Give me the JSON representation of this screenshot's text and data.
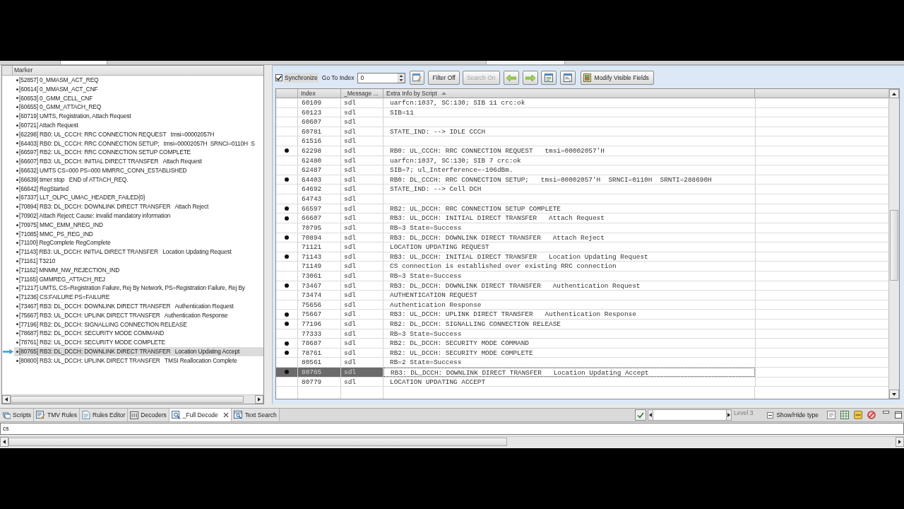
{
  "marker_panel": {
    "header": "Marker",
    "items": [
      {
        "text": "[52857] 0_MMASM_ACT_REQ",
        "selected": false
      },
      {
        "text": "[60614] 0_MMASM_ACT_CNF",
        "selected": false
      },
      {
        "text": "[60653] 0_GMM_CELL_CNF",
        "selected": false
      },
      {
        "text": "[60655] 0_GMM_ATTACH_REQ",
        "selected": false
      },
      {
        "text": "[60719] UMTS, Registration, Attach Request",
        "selected": false
      },
      {
        "text": "[60721] Attach Request",
        "selected": false
      },
      {
        "text": "[62298] RB0: UL_CCCH: RRC CONNECTION REQUEST   tmsi=00002057H",
        "selected": false
      },
      {
        "text": "[64403] RB0: DL_CCCH: RRC CONNECTION SETUP;   tmsi=00002057H  SRNCI=0110H  S",
        "selected": false
      },
      {
        "text": "[66597] RB2: UL_DCCH: RRC CONNECTION SETUP COMPLETE",
        "selected": false
      },
      {
        "text": "[66607] RB3: UL_DCCH: INITIAL DIRECT TRANSFER   Attach Request",
        "selected": false
      },
      {
        "text": "[66632] UMTS CS=000 PS=000 MMRRC_CONN_ESTABLISHED",
        "selected": false
      },
      {
        "text": "[66639] timer stop   END of ATTACH_REQ.",
        "selected": false
      },
      {
        "text": "[66642] RegStarted",
        "selected": false
      },
      {
        "text": "[67337] LLT_OLPC_UMAC_HEADER_FAILED{0}",
        "selected": false
      },
      {
        "text": "[70894] RB3: DL_DCCH: DOWNLINK DIRECT TRANSFER   Attach Reject",
        "selected": false
      },
      {
        "text": "[70902] Attach Reject; Cause: Invalid mandatory information",
        "selected": false
      },
      {
        "text": "[70975] MMC_EMM_NREG_IND",
        "selected": false
      },
      {
        "text": "[71085] MMC_PS_REG_IND",
        "selected": false
      },
      {
        "text": "[71100] RegComplete RegComplete",
        "selected": false
      },
      {
        "text": "[71143] RB3: UL_DCCH: INITIAL DIRECT TRANSFER   Location Updating Request",
        "selected": false
      },
      {
        "text": "[71161] T3210",
        "selected": false
      },
      {
        "text": "[71162] MNMM_NW_REJECTION_IND",
        "selected": false
      },
      {
        "text": "[71165] GMMREG_ATTACH_REJ",
        "selected": false
      },
      {
        "text": "[71217] UMTS, CS=Registration Failure, Rej By Network, PS=Registration Failure, Rej By",
        "selected": false
      },
      {
        "text": "[71236] CS:FAILURE PS=FAILURE",
        "selected": false
      },
      {
        "text": "[73467] RB3: DL_DCCH: DOWNLINK DIRECT TRANSFER   Authentication Request",
        "selected": false
      },
      {
        "text": "[75667] RB3: UL_DCCH: UPLINK DIRECT TRANSFER   Authentication Response",
        "selected": false
      },
      {
        "text": "[77196] RB2: DL_DCCH: SIGNALLING CONNECTION RELEASE",
        "selected": false
      },
      {
        "text": "[78687] RB2: DL_DCCH: SECURITY MODE COMMAND",
        "selected": false
      },
      {
        "text": "[78761] RB2: UL_DCCH: SECURITY MODE COMPLETE",
        "selected": false
      },
      {
        "text": "[80765] RB3: DL_DCCH: DOWNLINK DIRECT TRANSFER   Location Updating Accept",
        "selected": true
      },
      {
        "text": "[80800] RB3: UL_DCCH: UPLINK DIRECT TRANSFER   TMSI Reallocation Complete",
        "selected": false
      }
    ]
  },
  "toolbar": {
    "synchronize": {
      "label": "Synchronize",
      "checked": true
    },
    "go_to_index": {
      "label": "Go To Index",
      "value": "0"
    },
    "filter_button": {
      "label": "Filter Off"
    },
    "search_button": {
      "label": "Search On",
      "disabled": true
    },
    "modify_button": {
      "label": "Modify Visible Fields"
    }
  },
  "table": {
    "columns": [
      {
        "label": "Index",
        "sorted": false
      },
      {
        "label": "_Message ...",
        "sorted": false
      },
      {
        "label": "Extra Info by Script",
        "sorted": true
      }
    ],
    "rows": [
      {
        "marked": false,
        "selected": false,
        "index": "60109",
        "message": "sdl",
        "info": "uarfcn:1037, SC:130; SIB 11 crc:ok"
      },
      {
        "marked": false,
        "selected": false,
        "index": "60123",
        "message": "sdl",
        "info": "SIB=11"
      },
      {
        "marked": false,
        "selected": false,
        "index": "60607",
        "message": "sdl"
      },
      {
        "marked": false,
        "selected": false,
        "index": "60781",
        "message": "sdl",
        "info": "STATE_IND: --> IDLE CCCH"
      },
      {
        "marked": false,
        "selected": false,
        "index": "61516",
        "message": "sdl"
      },
      {
        "marked": true,
        "selected": false,
        "index": "62298",
        "message": "sdl",
        "info": "RB0: UL_CCCH: RRC CONNECTION REQUEST   tmsi=00002057'H"
      },
      {
        "marked": false,
        "selected": false,
        "index": "62480",
        "message": "sdl",
        "info": "uarfcn:1037, SC:130; SIB 7 crc:ok"
      },
      {
        "marked": false,
        "selected": false,
        "index": "62487",
        "message": "sdl",
        "info": "SIB=7; ul_Interference=-106dBm."
      },
      {
        "marked": true,
        "selected": false,
        "index": "64403",
        "message": "sdl",
        "info": "RB0: DL_CCCH: RRC CONNECTION SETUP;   tmsi=00002057'H  SRNCI=0110H  SRNTI=288690H"
      },
      {
        "marked": false,
        "selected": false,
        "index": "64692",
        "message": "sdl",
        "info": "STATE_IND: --> Cell DCH"
      },
      {
        "marked": false,
        "selected": false,
        "index": "64743",
        "message": "sdl"
      },
      {
        "marked": true,
        "selected": false,
        "index": "66597",
        "message": "sdl",
        "info": "RB2: UL_DCCH: RRC CONNECTION SETUP COMPLETE"
      },
      {
        "marked": true,
        "selected": false,
        "index": "66607",
        "message": "sdl",
        "info": "RB3: UL_DCCH: INITIAL DIRECT TRANSFER   Attach Request"
      },
      {
        "marked": false,
        "selected": false,
        "index": "70795",
        "message": "sdl",
        "info": "RB=3 State=Success"
      },
      {
        "marked": true,
        "selected": false,
        "index": "70894",
        "message": "sdl",
        "info": "RB3: DL_DCCH: DOWNLINK DIRECT TRANSFER   Attach Reject"
      },
      {
        "marked": false,
        "selected": false,
        "index": "71121",
        "message": "sdl",
        "info": "LOCATION UPDATING REQUEST"
      },
      {
        "marked": true,
        "selected": false,
        "index": "71143",
        "message": "sdl",
        "info": "RB3: UL_DCCH: INITIAL DIRECT TRANSFER   Location Updating Request"
      },
      {
        "marked": false,
        "selected": false,
        "index": "71149",
        "message": "sdl",
        "info": "CS connection is established over existing RRC connection"
      },
      {
        "marked": false,
        "selected": false,
        "index": "73061",
        "message": "sdl",
        "info": "RB=3 State=Success"
      },
      {
        "marked": true,
        "selected": false,
        "index": "73467",
        "message": "sdl",
        "info": "RB3: DL_DCCH: DOWNLINK DIRECT TRANSFER   Authentication Request"
      },
      {
        "marked": false,
        "selected": false,
        "index": "73474",
        "message": "sdl",
        "info": "AUTHENTICATION REQUEST"
      },
      {
        "marked": false,
        "selected": false,
        "index": "75656",
        "message": "sdl",
        "info": "Authentication Response"
      },
      {
        "marked": true,
        "selected": false,
        "index": "75667",
        "message": "sdl",
        "info": "RB3: UL_DCCH: UPLINK DIRECT TRANSFER   Authentication Response"
      },
      {
        "marked": true,
        "selected": false,
        "index": "77196",
        "message": "sdl",
        "info": "RB2: DL_DCCH: SIGNALLING CONNECTION RELEASE"
      },
      {
        "marked": false,
        "selected": false,
        "index": "77333",
        "message": "sdl",
        "info": "RB=3 State=Success"
      },
      {
        "marked": true,
        "selected": false,
        "index": "78687",
        "message": "sdl",
        "info": "RB2: DL_DCCH: SECURITY MODE COMMAND"
      },
      {
        "marked": true,
        "selected": false,
        "index": "78761",
        "message": "sdl",
        "info": "RB2: UL_DCCH: SECURITY MODE COMPLETE"
      },
      {
        "marked": false,
        "selected": false,
        "index": "80561",
        "message": "sdl",
        "info": "RB=2 State=Success"
      },
      {
        "marked": true,
        "selected": true,
        "index": "80765",
        "message": "sdl",
        "info": "RB3: DL_DCCH: DOWNLINK DIRECT TRANSFER   Location Updating Accept"
      },
      {
        "marked": false,
        "selected": false,
        "index": "80779",
        "message": "sdl",
        "info": "LOCATION UPDATING ACCEPT"
      }
    ]
  },
  "bottom_tabs": [
    {
      "label": "Scripts",
      "selected": false,
      "closable": false
    },
    {
      "label": "TMV Rules",
      "selected": false,
      "closable": false
    },
    {
      "label": "Rules Editor",
      "selected": false,
      "closable": false
    },
    {
      "label": "Decoders",
      "selected": false,
      "closable": false
    },
    {
      "label": "_Full Decode",
      "selected": true,
      "closable": true
    },
    {
      "label": "Text Search",
      "selected": false,
      "closable": false
    }
  ],
  "status_controls": {
    "level_label": {
      "text": "Level 3",
      "disabled": true
    },
    "show_hide_button": {
      "label": "Show/Hide type"
    }
  },
  "command_field": {
    "value": "cs"
  }
}
